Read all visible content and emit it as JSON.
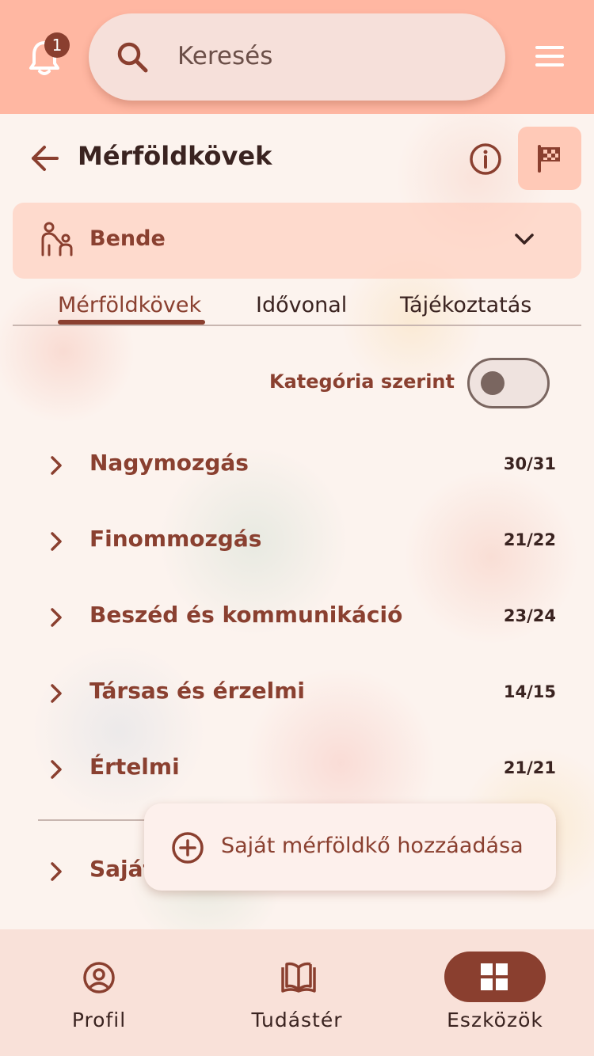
{
  "header": {
    "notification_count": "1",
    "search_placeholder": "Keresés"
  },
  "page": {
    "title": "Mérföldkövek"
  },
  "child_selector": {
    "name": "Bende"
  },
  "tabs": [
    {
      "label": "Mérföldkövek",
      "active": true
    },
    {
      "label": "Idővonal",
      "active": false
    },
    {
      "label": "Tájékoztatás",
      "active": false
    }
  ],
  "toggle": {
    "label": "Kategória szerint",
    "on": false
  },
  "categories": [
    {
      "name": "Nagymozgás",
      "count": "30/31"
    },
    {
      "name": "Finommozgás",
      "count": "21/22"
    },
    {
      "name": "Beszéd és kommunikáció",
      "count": "23/24"
    },
    {
      "name": "Társas és érzelmi",
      "count": "14/15"
    },
    {
      "name": "Értelmi",
      "count": "21/21"
    },
    {
      "name": "Saját",
      "count": ""
    }
  ],
  "fab": {
    "label": "Saját mérföldkő hozzáadása"
  },
  "bottom_nav": [
    {
      "label": "Profil",
      "icon": "profile-icon",
      "active": false
    },
    {
      "label": "Tudástér",
      "icon": "book-icon",
      "active": false
    },
    {
      "label": "Eszközök",
      "icon": "grid-icon",
      "active": true
    }
  ],
  "colors": {
    "topbar": "#ffb7a2",
    "accent": "#8a3f2f",
    "text_dark": "#3a2320"
  }
}
